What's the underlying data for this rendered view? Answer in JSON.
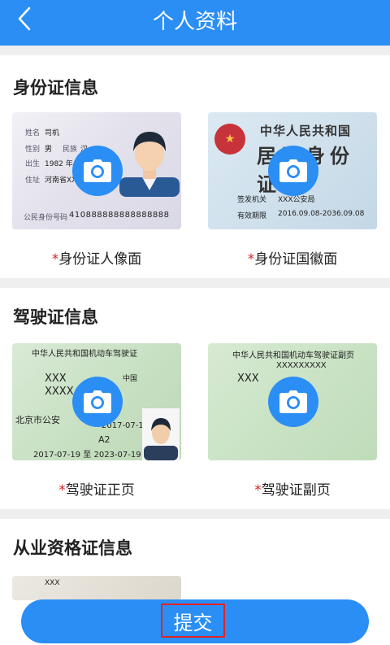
{
  "header": {
    "title": "个人资料"
  },
  "sections": {
    "id_card": {
      "title": "身份证信息",
      "front": {
        "required_mark": "*",
        "caption": "身份证人像面",
        "sample_name_label": "姓名",
        "sample_name": "司机",
        "sample_gender_label": "性别",
        "sample_gender": "男",
        "sample_ethnicity_label": "民族",
        "sample_ethnicity": "汉",
        "sample_birth_label": "出生",
        "sample_birth_year": "1982 年",
        "sample_address_label": "住址",
        "sample_address": "河南省XXX",
        "sample_number_label": "公民身份号码",
        "sample_number": "410888888888888888"
      },
      "back": {
        "required_mark": "*",
        "caption": "身份证国徽面",
        "sample_heading": "中华人民共和国",
        "sample_subheading": "居民身份证",
        "sample_authority_label": "签发机关",
        "sample_authority": "XXX公安局",
        "sample_validity_label": "有效期限",
        "sample_validity": "2016.09.08-2036.09.08"
      }
    },
    "driver_license": {
      "title": "驾驶证信息",
      "front": {
        "required_mark": "*",
        "caption": "驾驶证正页",
        "sample_heading": "中华人民共和国机动车驾驶证",
        "sample_name": "XXX",
        "sample_address": "XXXX",
        "sample_class": "A2",
        "sample_date": "2017-07-19",
        "sample_range": "2017-07-19 至 2023-07-19",
        "sample_issuer": "北京市公安",
        "sample_nationality": "中国"
      },
      "back": {
        "required_mark": "*",
        "caption": "驾驶证副页",
        "sample_heading": "中华人民共和国机动车驾驶证副页",
        "sample_number": "XXXXXXXXX",
        "sample_name": "XXX"
      }
    },
    "qualification": {
      "title": "从业资格证信息",
      "sample_name": "XXX"
    }
  },
  "submit": {
    "label": "提交"
  },
  "colors": {
    "primary": "#2b8ef5",
    "required": "#e02424",
    "background": "#efefef"
  }
}
